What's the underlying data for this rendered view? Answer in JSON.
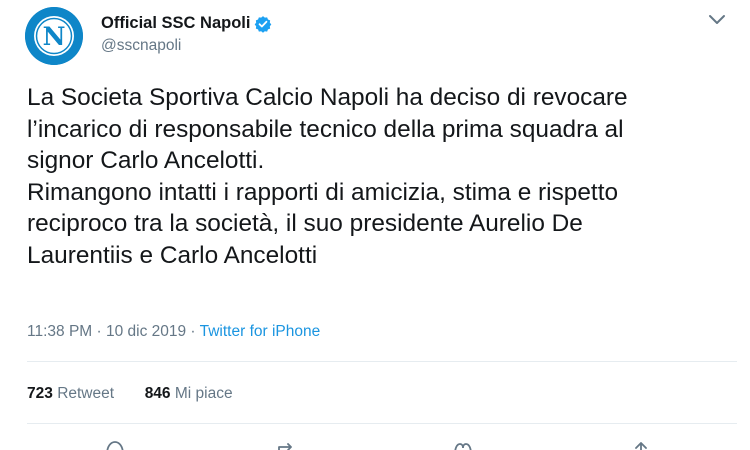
{
  "account": {
    "display_name": "Official SSC Napoli",
    "handle": "@sscnapoli",
    "verified": true,
    "avatar_letter": "N"
  },
  "tweet": {
    "paragraphs": [
      [
        "La Societa Sportiva Calcio Napoli ha deciso di revocare",
        "l’incarico di responsabile tecnico della prima squadra al",
        "signor Carlo Ancelotti."
      ],
      [
        "Rimangono intatti i rapporti di amicizia, stima e rispetto",
        "reciproco tra la società, il suo presidente Aurelio De",
        "Laurentiis e Carlo Ancelotti"
      ]
    ],
    "timestamp": "11:38 PM · 10 dic 2019",
    "separator": " · ",
    "source": "Twitter for iPhone"
  },
  "stats": {
    "retweets_count": "723",
    "retweets_label": "Retweet",
    "likes_count": "846",
    "likes_label": "Mi piace"
  },
  "icons": {
    "verified": "verified-badge-icon",
    "menu": "chevron-down-icon",
    "actions": [
      "reply-icon",
      "retweet-icon",
      "like-icon",
      "share-icon"
    ]
  },
  "colors": {
    "brand": "#1da1f2",
    "link": "#1b95e0",
    "secondary_text": "#657786",
    "primary_text": "#14171a",
    "divider": "#e6ecf0",
    "avatar_bg": "#0e86c8"
  }
}
